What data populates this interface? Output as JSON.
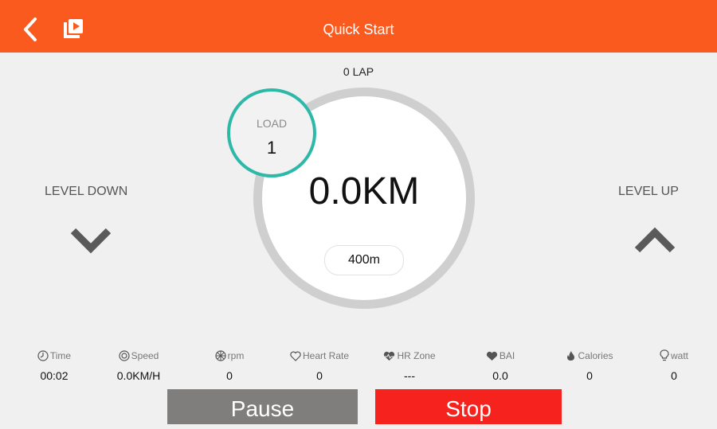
{
  "header": {
    "title": "Quick Start",
    "back_icon": "chevron-left-icon",
    "video_icon": "video-playlist-icon",
    "bg_color": "#fb5a1e"
  },
  "workout": {
    "lap_text": "0 LAP",
    "distance": "0.0KM",
    "lap_length": "400m",
    "load_label": "LOAD",
    "load_value": "1",
    "load_ring_color": "#2db8a8"
  },
  "controls": {
    "level_down_label": "LEVEL DOWN",
    "level_up_label": "LEVEL UP",
    "pause_label": "Pause",
    "stop_label": "Stop",
    "pause_color": "#807e7c",
    "stop_color": "#f5221e"
  },
  "stats": [
    {
      "label": "Time",
      "value": "00:02",
      "icon": "clock-icon"
    },
    {
      "label": "Speed",
      "value": "0.0KM/H",
      "icon": "speed-icon"
    },
    {
      "label": "rpm",
      "value": "0",
      "icon": "wheel-icon"
    },
    {
      "label": "Heart Rate",
      "value": "0",
      "icon": "heart-outline-icon"
    },
    {
      "label": "HR Zone",
      "value": "---",
      "icon": "heart-pulse-icon"
    },
    {
      "label": "BAI",
      "value": "0.0",
      "icon": "heart-bai-icon"
    },
    {
      "label": "Calories",
      "value": "0",
      "icon": "flame-icon"
    },
    {
      "label": "watt",
      "value": "0",
      "icon": "bulb-icon"
    }
  ]
}
